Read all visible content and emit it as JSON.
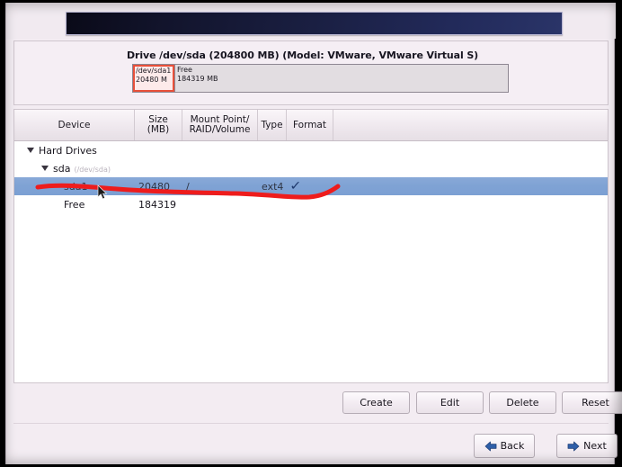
{
  "window": {
    "banner_label": ""
  },
  "drive": {
    "title": "Drive /dev/sda (204800 MB) (Model: VMware, VMware Virtual S)",
    "segments": [
      {
        "name": "/dev/sda1",
        "size": "20480 M",
        "selected": true
      },
      {
        "name": "Free",
        "size": "184319 MB",
        "selected": false
      }
    ],
    "selected_border_color": "#e8503a"
  },
  "table": {
    "headers": [
      {
        "label": "Device"
      },
      {
        "label": "Size\n(MB)",
        "line1": "Size",
        "line2": "(MB)"
      },
      {
        "label": "Mount Point/\nRAID/Volume",
        "line1": "Mount Point/",
        "line2": "RAID/Volume"
      },
      {
        "label": "Type"
      },
      {
        "label": "Format"
      }
    ],
    "rows": [
      {
        "indent": 0,
        "expander": "triangle-down",
        "device": "Hard Drives",
        "device_path": "",
        "size": "",
        "mount": "",
        "type": "",
        "format": "",
        "selected": false
      },
      {
        "indent": 1,
        "expander": "triangle-down",
        "device": "sda",
        "device_path": "(/dev/sda)",
        "size": "",
        "mount": "",
        "type": "",
        "format": "",
        "selected": false
      },
      {
        "indent": 2,
        "expander": "",
        "device": "sda1",
        "device_path": "",
        "size": "20480",
        "mount": "/",
        "type": "ext4",
        "format": "✓",
        "selected": true
      },
      {
        "indent": 2,
        "expander": "",
        "device": "Free",
        "device_path": "",
        "size": "184319",
        "mount": "",
        "type": "",
        "format": "",
        "selected": false
      }
    ],
    "selection_color": "#7fa2d4"
  },
  "actions": {
    "create": "Create",
    "edit": "Edit",
    "delete": "Delete",
    "reset": "Reset"
  },
  "navigation": {
    "back": "Back",
    "next": "Next",
    "arrow_color": "#2f5fa8"
  },
  "annotation": {
    "color": "#ee1c1c",
    "description": "hand-drawn red underline beneath the selected sda1 partition row"
  }
}
